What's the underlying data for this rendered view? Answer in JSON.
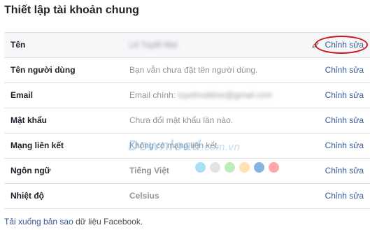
{
  "page": {
    "title": "Thiết lập tài khoản chung"
  },
  "rows": [
    {
      "label": "Tên",
      "value": "Lê Tuyết Mai",
      "edit": "Chỉnh sửa"
    },
    {
      "label": "Tên người dùng",
      "value": "Bạn vẫn chưa đặt tên người dùng.",
      "edit": "Chỉnh sửa"
    },
    {
      "label": "Email",
      "value_prefix": "Email chính: ",
      "value": "tuyetmaitime@gmail.com",
      "edit": "Chỉnh sửa"
    },
    {
      "label": "Mật khẩu",
      "value": "Chưa đổi mật khẩu lần nào.",
      "edit": "Chỉnh sửa"
    },
    {
      "label": "Mạng liên kết",
      "value": "Không có mạng liên kết.",
      "edit": "Chỉnh sửa"
    },
    {
      "label": "Ngôn ngữ",
      "value": "Tiếng Việt",
      "edit": "Chỉnh sửa"
    },
    {
      "label": "Nhiệt độ",
      "value": "Celsius",
      "edit": "Chỉnh sửa"
    }
  ],
  "footer": {
    "text_prefix": "Tải xuống bản sao",
    "link": " dữ liệu Facebook",
    "suffix": "."
  },
  "watermark": {
    "main": "Download",
    "sub": ".com.vn"
  },
  "colors": {
    "link": "#365899",
    "highlight_circle": "#d0121b",
    "dots": [
      "#8fd3f4",
      "#d9d9d9",
      "#a8e6a1",
      "#ffd89b",
      "#5b9bd5",
      "#ff8a8a"
    ]
  }
}
